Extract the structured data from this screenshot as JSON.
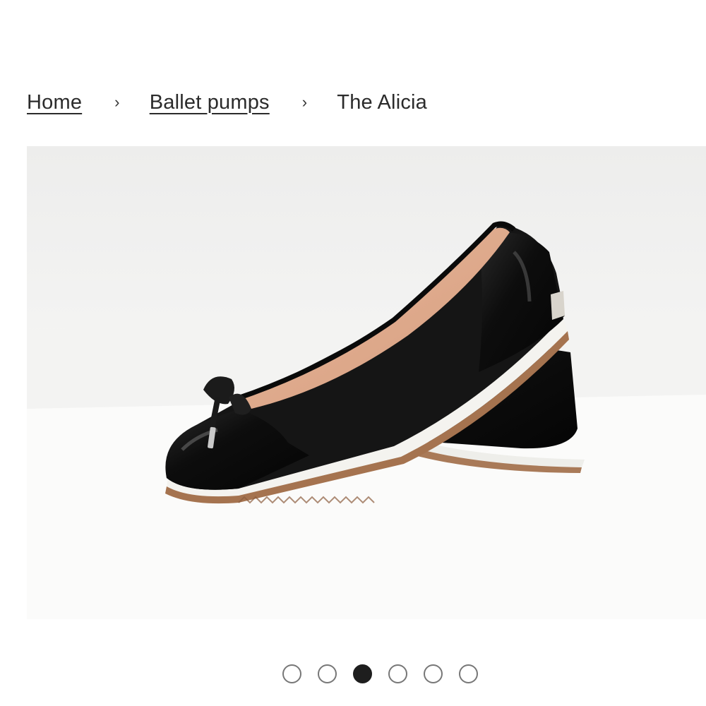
{
  "breadcrumb": {
    "items": [
      {
        "label": "Home"
      },
      {
        "label": "Ballet pumps"
      }
    ],
    "separator": "›",
    "current": "The Alicia"
  },
  "gallery": {
    "image_alt": "The Alicia black patent ballet pumps with bow",
    "slide_count": 6,
    "active_slide": 3
  },
  "colors": {
    "active_dot": "#1e1e1e",
    "inactive_dot_border": "#777777"
  }
}
